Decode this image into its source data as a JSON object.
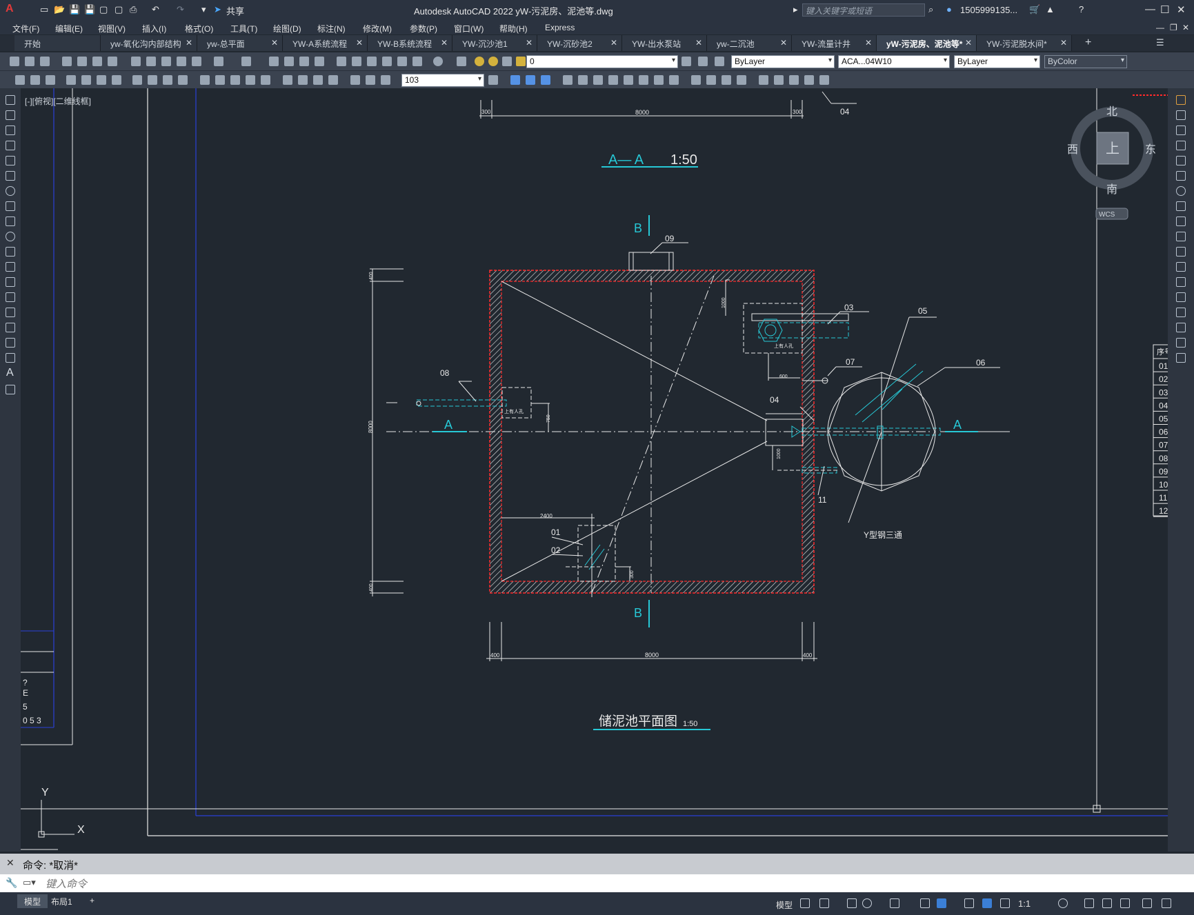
{
  "app": {
    "title": "Autodesk AutoCAD 2022    yW-污泥房、泥池等.dwg",
    "share_label": "共享",
    "search_placeholder": "键入关键字或短语",
    "user": "1505999135...",
    "logo_letter": "A"
  },
  "menu": [
    "文件(F)",
    "编辑(E)",
    "视图(V)",
    "插入(I)",
    "格式(O)",
    "工具(T)",
    "绘图(D)",
    "标注(N)",
    "修改(M)",
    "参数(P)",
    "窗口(W)",
    "帮助(H)",
    "Express"
  ],
  "tabs": [
    {
      "label": "开始",
      "closable": false
    },
    {
      "label": "yw-氧化沟内部结构",
      "closable": true
    },
    {
      "label": "yw-总平面",
      "closable": true
    },
    {
      "label": "YW-A系统流程",
      "closable": true
    },
    {
      "label": "YW-B系统流程",
      "closable": true
    },
    {
      "label": "YW-沉沙池1",
      "closable": true
    },
    {
      "label": "YW-沉砂池2",
      "closable": true
    },
    {
      "label": "YW-出水泵站",
      "closable": true
    },
    {
      "label": "yw-二沉池",
      "closable": true
    },
    {
      "label": "YW-流量计井",
      "closable": true
    },
    {
      "label": "yW-污泥房、泥池等*",
      "closable": true,
      "active": true
    },
    {
      "label": "YW-污泥脱水间*",
      "closable": true
    }
  ],
  "toolbar": {
    "layer_value": "0",
    "color_value": "ByLayer",
    "linetype_value": "ACA...04W10",
    "lineweight_value": "ByLayer",
    "plotstyle_value": "ByColor",
    "dimstyle_value": "103"
  },
  "viewport": {
    "label": "[-][俯视][二维线框]",
    "viewcube": {
      "north": "北",
      "south": "南",
      "east": "东",
      "west": "西",
      "top": "上",
      "wcs": "WCS"
    },
    "ucs": {
      "x": "X",
      "y": "Y"
    }
  },
  "drawing": {
    "section_title": "A— A",
    "section_scale": "1:50",
    "plan_title": "储泥池平面图",
    "plan_scale": "1:50",
    "section_letter_a": "A",
    "section_letter_b": "B",
    "callouts": [
      "01",
      "02",
      "03",
      "04",
      "05",
      "06",
      "07",
      "08",
      "09",
      "11"
    ],
    "top_callout": "04",
    "dim_top": [
      "300",
      "8000",
      "300"
    ],
    "dim_bottom": [
      "400",
      "8000",
      "400"
    ],
    "dim_misc": {
      "d1000a": "1000",
      "d600": "600",
      "d750": "750",
      "d1000b": "1000",
      "d2400": "2400",
      "d300": "300",
      "d8000v": "8000",
      "d400v1": "400",
      "d400v2": "400"
    },
    "manhole_label": "上有人孔",
    "tee_label": "Y型钢三通",
    "left_table_fragments": [
      "?",
      "E",
      "5",
      "0  5  3"
    ],
    "right_table_header": "序号",
    "right_table_rows": [
      "01",
      "02",
      "03",
      "04",
      "05",
      "06",
      "07",
      "08",
      "09",
      "10",
      "11",
      "12"
    ]
  },
  "command": {
    "history": "命令: *取消*",
    "placeholder": "键入命令"
  },
  "status": {
    "layout_tabs": [
      "模型",
      "布局1"
    ],
    "add_tab": "+",
    "model_label": "模型",
    "scale": "1:1"
  }
}
